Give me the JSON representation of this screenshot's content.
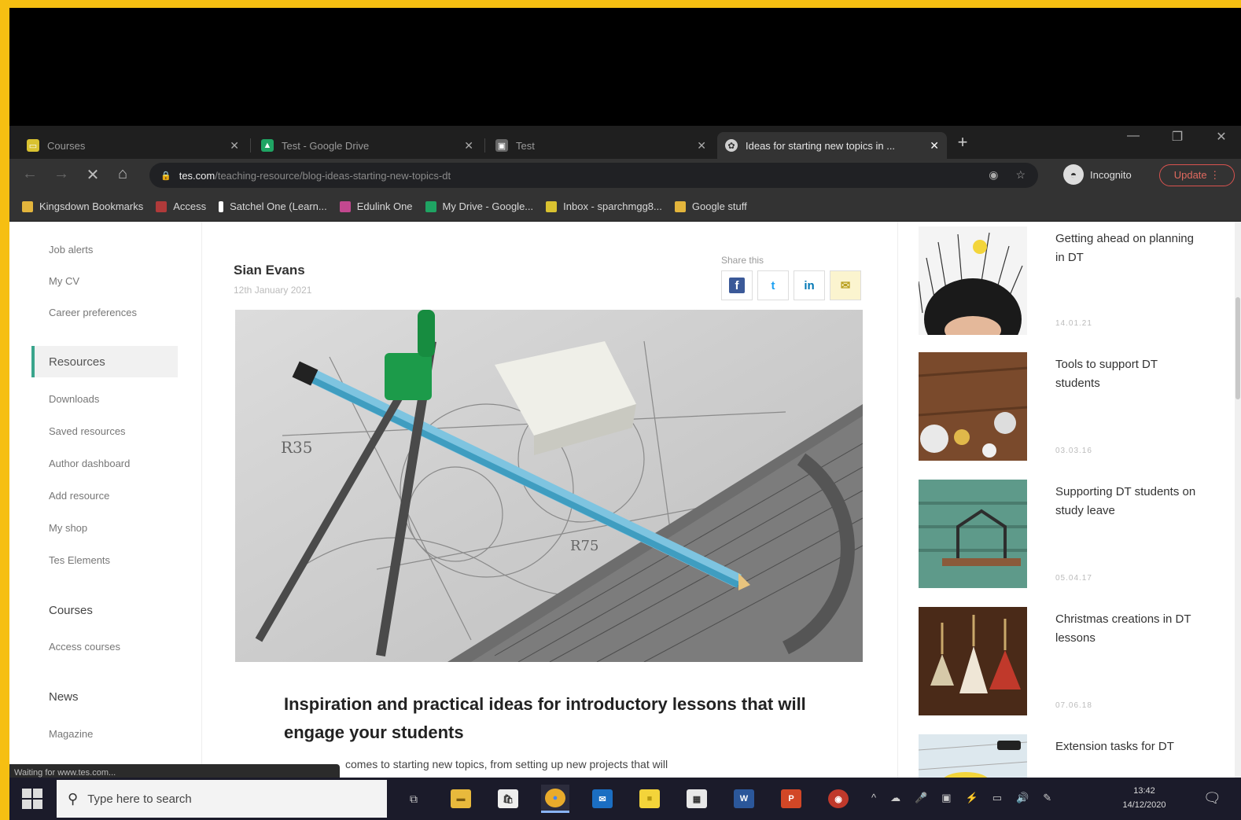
{
  "browser": {
    "tabs": [
      {
        "title": "Courses",
        "icon_color": "#d9c230",
        "icon": "classroom-icon"
      },
      {
        "title": "Test - Google Drive",
        "icon_color": "#1fa463",
        "icon": "google-drive-icon"
      },
      {
        "title": "Test",
        "icon_color": "#8a8a8a",
        "icon": "image-icon"
      },
      {
        "title": "Ideas for starting new topics in ...",
        "icon_color": "#cfcfcf",
        "icon": "tes-icon"
      }
    ],
    "close_glyph": "✕",
    "new_tab_glyph": "+",
    "window_controls": {
      "minimize": "—",
      "restore": "❐",
      "close": "✕"
    },
    "nav": {
      "back": "←",
      "forward": "→",
      "stop": "✕",
      "home": "⌂"
    },
    "url_host": "tes.com",
    "url_path": "/teaching-resource/blog-ideas-starting-new-topics-dt",
    "omnibox_icons": {
      "privacy": "◉",
      "bookmark": "☆"
    },
    "profile_label": "Incognito",
    "update_label": "Update ⋮",
    "bookmarks": [
      {
        "label": "Kingsdown Bookmarks",
        "color": "#e3b53c"
      },
      {
        "label": "Access",
        "color": "#b03a3a"
      },
      {
        "label": "Satchel One (Learn...",
        "color": "#ffffff"
      },
      {
        "label": "Edulink One",
        "color": "#c2488f"
      },
      {
        "label": "My Drive - Google...",
        "color": "#1fa463"
      },
      {
        "label": "Inbox - sparchmgg8...",
        "color": "#d9c230"
      },
      {
        "label": "Google stuff",
        "color": "#e3b53c"
      }
    ]
  },
  "left_nav": {
    "top_items": [
      "Job alerts",
      "My CV",
      "Career preferences"
    ],
    "current": "Resources",
    "resource_items": [
      "Downloads",
      "Saved resources",
      "Author dashboard",
      "Add resource",
      "My shop",
      "Tes Elements"
    ],
    "courses_heading": "Courses",
    "course_items": [
      "Access courses"
    ],
    "news_heading": "News",
    "news_items": [
      "Magazine"
    ]
  },
  "article": {
    "author": "Sian Evans",
    "date": "12th January 2021",
    "share_label": "Share this",
    "share_buttons": [
      {
        "name": "facebook",
        "glyph": "f",
        "color": "#3b5998"
      },
      {
        "name": "twitter",
        "glyph": "t",
        "color": "#1da1f2"
      },
      {
        "name": "linkedin",
        "glyph": "in",
        "color": "#0077b5"
      },
      {
        "name": "email",
        "glyph": "✉",
        "color": "#d9c230"
      }
    ],
    "headline": "Inspiration and practical ideas for introductory lessons that will engage your students",
    "body_fragment": "comes to starting new topics, from setting up new projects that will"
  },
  "status_text": "Waiting for www.tes.com...",
  "related": [
    {
      "title": "Getting ahead on planning in DT",
      "date": "14.01.21"
    },
    {
      "title": "Tools to support DT students",
      "date": "03.03.16"
    },
    {
      "title": "Supporting DT students on study leave",
      "date": "05.04.17"
    },
    {
      "title": "Christmas creations in DT lessons",
      "date": "07.06.18"
    },
    {
      "title": "Extension tasks for DT",
      "date": ""
    }
  ],
  "taskbar": {
    "search_placeholder": "Type here to search",
    "apps": [
      {
        "name": "task-view",
        "glyph": "⧉",
        "color": "transparent",
        "running": false
      },
      {
        "name": "file-explorer",
        "glyph": "▬",
        "color": "#e8b93c",
        "running": false
      },
      {
        "name": "store",
        "glyph": "🛍",
        "color": "#eee",
        "running": false
      },
      {
        "name": "chrome",
        "glyph": "●",
        "color": "#e9ab2b",
        "running": true
      },
      {
        "name": "mail",
        "glyph": "✉",
        "color": "#1b6ec2",
        "running": false
      },
      {
        "name": "sticky-notes",
        "glyph": "■",
        "color": "#f3d43a",
        "running": false
      },
      {
        "name": "calculator",
        "glyph": "▦",
        "color": "#e8e8e8",
        "running": false
      },
      {
        "name": "word",
        "glyph": "W",
        "color": "#2b579a",
        "running": false
      },
      {
        "name": "powerpoint",
        "glyph": "P",
        "color": "#d24726",
        "running": false
      },
      {
        "name": "screen-recorder",
        "glyph": "◉",
        "color": "#c0392b",
        "running": false
      }
    ],
    "tray_glyphs": [
      "^",
      "☁",
      "🎤",
      "▣",
      "⚡",
      "▭",
      "🔊",
      "✎"
    ],
    "clock_time": "13:42",
    "clock_date": "14/12/2020",
    "notification_glyph": "🗨"
  }
}
